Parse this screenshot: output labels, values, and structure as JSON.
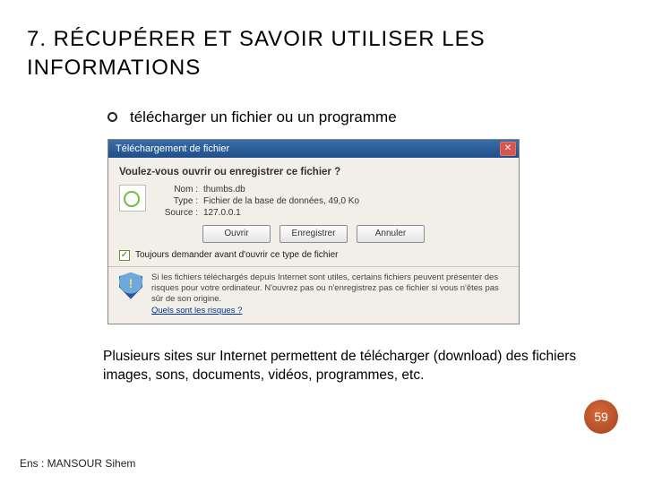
{
  "title_line1_a": "7. R",
  "title_line1_b": "ÉCUPÉRER",
  "title_line1_c": " ET",
  "title_line1_d": " SAVOIR",
  "title_line1_e": " UTILISER",
  "title_line1_f": " LES",
  "title_line2": "INFORMATIONS",
  "bullet": "télécharger un fichier ou un programme",
  "dialog": {
    "title": "Téléchargement de fichier",
    "close": "✕",
    "question": "Voulez-vous ouvrir ou enregistrer ce fichier ?",
    "labels": {
      "name": "Nom :",
      "type": "Type :",
      "source": "Source :"
    },
    "values": {
      "name": "thumbs.db",
      "type": "Fichier de la base de données, 49,0 Ko",
      "source": "127.0.0.1"
    },
    "buttons": {
      "open": "Ouvrir",
      "save": "Enregistrer",
      "cancel": "Annuler"
    },
    "checkbox_checked": "✓",
    "checkbox_label": "Toujours demander avant d'ouvrir ce type de fichier",
    "warning": "Si les fichiers téléchargés depuis Internet sont utiles, certains fichiers peuvent présenter des risques pour votre ordinateur. N'ouvrez pas ou n'enregistrez pas ce fichier si vous n'êtes pas sûr de son origine.",
    "risk_link": "Quels sont les risques ?"
  },
  "body_text": "Plusieurs sites sur Internet permettent de télécharger (download) des fichiers images, sons, documents, vidéos, programmes, etc.",
  "page_number": "59",
  "footer": "Ens : MANSOUR Sihem"
}
